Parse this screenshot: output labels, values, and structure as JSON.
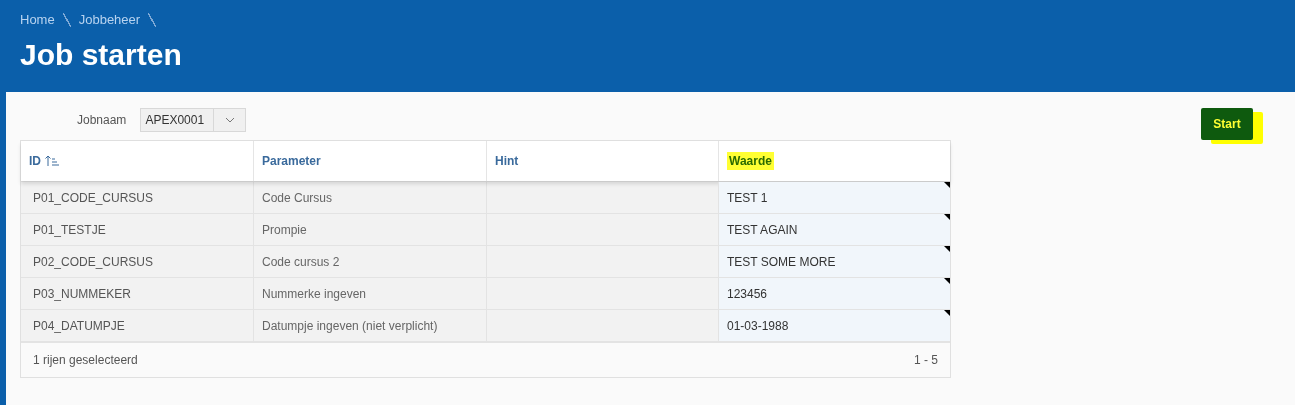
{
  "breadcrumb": [
    "Home",
    "Jobbeheer"
  ],
  "title": "Job starten",
  "jobnaam": {
    "label": "Jobnaam",
    "value": "APEX0001"
  },
  "start_button": {
    "label": "Start",
    "highlighted": true
  },
  "table": {
    "columns": [
      {
        "label": "ID",
        "sorted": true,
        "highlighted": false
      },
      {
        "label": "Parameter",
        "sorted": false,
        "highlighted": false
      },
      {
        "label": "Hint",
        "sorted": false,
        "highlighted": false
      },
      {
        "label": "Waarde",
        "sorted": false,
        "highlighted": true
      }
    ],
    "rows": [
      {
        "id": "P01_CODE_CURSUS",
        "parameter": "Code Cursus",
        "waarde": "TEST 1"
      },
      {
        "id": "P01_TESTJE",
        "parameter": "Prompie",
        "waarde": "TEST AGAIN"
      },
      {
        "id": "P02_CODE_CURSUS",
        "parameter": "Code cursus 2",
        "waarde": "TEST SOME MORE"
      },
      {
        "id": "P03_NUMMEKER",
        "parameter": "Nummerke ingeven",
        "waarde": "123456"
      },
      {
        "id": "P04_DATUMPJE",
        "parameter": "Datumpje ingeven (niet verplicht)",
        "waarde": "01-03-1988"
      }
    ],
    "status": "1 rijen geselecteerd",
    "range": "1 - 5"
  }
}
